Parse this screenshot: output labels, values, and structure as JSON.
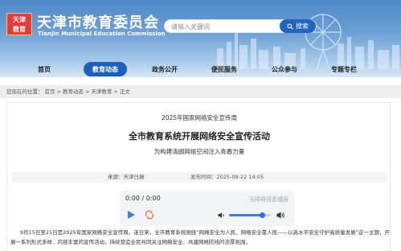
{
  "header": {
    "logo_text": "天津\n教育",
    "title": "天津市教育委员会",
    "subtitle": "Tianjin Municipal Education Commission",
    "search_placeholder": "请输入关键词",
    "search_button": "搜索"
  },
  "nav": {
    "items": [
      {
        "label": "首页",
        "active": false
      },
      {
        "label": "教育动态",
        "active": true
      },
      {
        "label": "政务公开",
        "active": false
      },
      {
        "label": "便民服务",
        "active": false
      },
      {
        "label": "公众参与",
        "active": false
      },
      {
        "label": "专题专栏",
        "active": false
      }
    ]
  },
  "breadcrumb": {
    "prefix": "您现在的位置：",
    "items": [
      "首页",
      "教育动态",
      "天津教育",
      "正文"
    ],
    "separator": ">"
  },
  "article": {
    "kicker": "2025年国家网络安全宣传周",
    "headline": "全市教育系统开展网络安全宣传活动",
    "subtitle": "为构建清朗网络空间注入青春力量",
    "source_label": "来源：",
    "source": "天津日报",
    "time_label": "发布时间：",
    "time": "2025-09-22 14:05",
    "body": "9月15日至21日是2025年国家网络安全宣传周。连日来，全市教育系统围绕“网络安全为人民、网络安全靠人民——以高水平安全守护高质量发展”这一主题，开展一系列形式多样、内容丰富的宣传活动，持续营造全民共同关注网络安全、共建网络防线的浓厚氛围。"
  },
  "player": {
    "time": "0:00 / 0:00",
    "label": "无障碍语音播报",
    "volume": 0.8,
    "icons": [
      "play-icon",
      "loop-icon",
      "volume-low-icon",
      "volume-high-icon"
    ]
  },
  "colors": {
    "header_top": "#4e88c8",
    "nav_active": "#1c5fbd",
    "search_button": "#1f64c1",
    "logo_red": "#e8393d"
  }
}
